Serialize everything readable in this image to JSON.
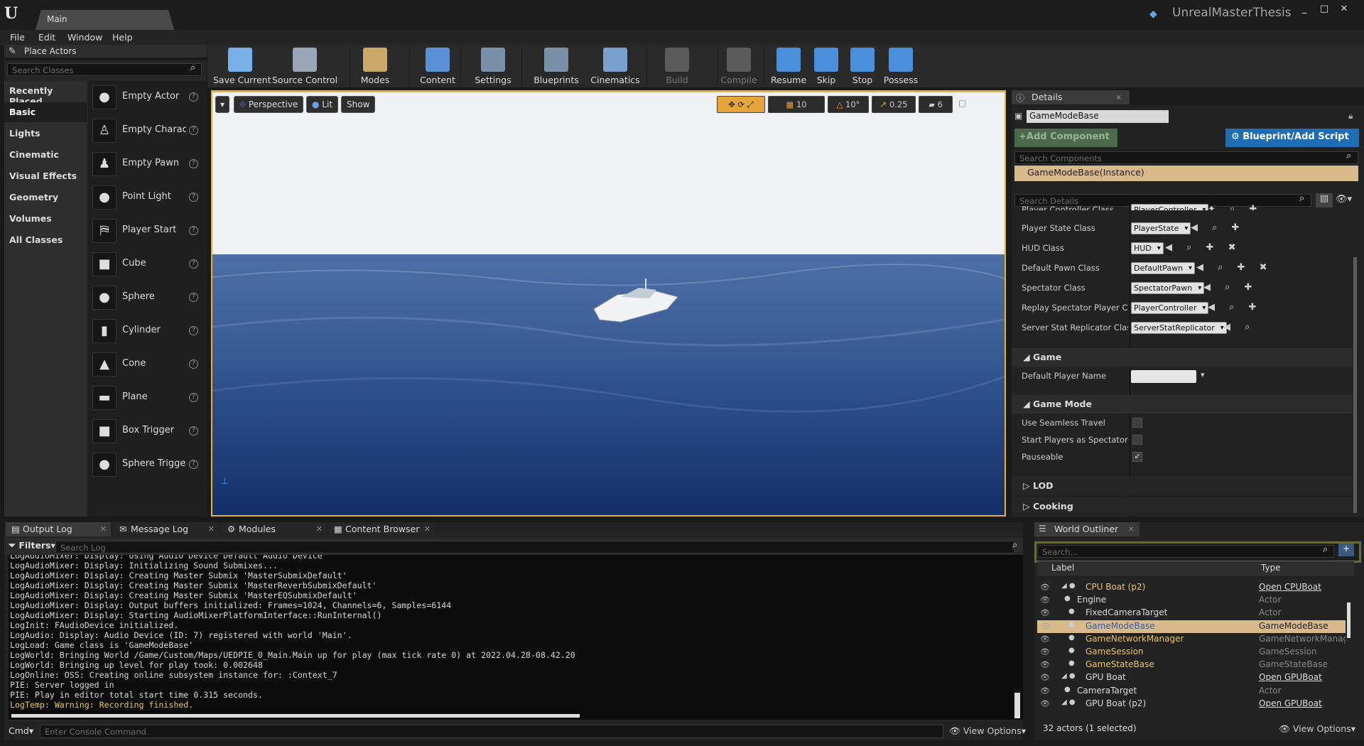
{
  "app": {
    "tab": "Main",
    "project": "UnrealMasterThesis",
    "win_min": "_",
    "win_max": "□",
    "win_close": "✕"
  },
  "menu": [
    "File",
    "Edit",
    "Window",
    "Help"
  ],
  "place_actors": {
    "title": "Place Actors",
    "search_placeholder": "Search Classes",
    "categories": [
      "Recently Placed",
      "Basic",
      "Lights",
      "Cinematic",
      "Visual Effects",
      "Geometry",
      "Volumes",
      "All Classes"
    ],
    "selected_category": "Basic",
    "actors": [
      "Empty Actor",
      "Empty Character",
      "Empty Pawn",
      "Point Light",
      "Player Start",
      "Cube",
      "Sphere",
      "Cylinder",
      "Cone",
      "Plane",
      "Box Trigger",
      "Sphere Trigger"
    ]
  },
  "toolbar": [
    "Save Current",
    "Source Control",
    "Modes",
    "Content",
    "Settings",
    "Blueprints",
    "Cinematics",
    "Build",
    "Compile",
    "Resume",
    "Skip",
    "Stop",
    "Possess"
  ],
  "viewport": {
    "perspective": "Perspective",
    "lit": "Lit",
    "show": "Show",
    "grid": "10",
    "angle": "10°",
    "scale": "0.25",
    "camspeed": "6"
  },
  "details": {
    "title": "Details",
    "object_name": "GameModeBase",
    "add_component": "+Add Component",
    "blueprint_btn": "Blueprint/Add Script",
    "search_components": "Search Components",
    "instance": "GameModeBase(Instance)",
    "search_details": "Search Details",
    "props": [
      {
        "label": "Player Controller Class",
        "value": "PlayerController"
      },
      {
        "label": "Player State Class",
        "value": "PlayerState"
      },
      {
        "label": "HUD Class",
        "value": "HUD"
      },
      {
        "label": "Default Pawn Class",
        "value": "DefaultPawn"
      },
      {
        "label": "Spectator Class",
        "value": "SpectatorPawn"
      },
      {
        "label": "Replay Spectator Player Controller",
        "value": "PlayerController"
      },
      {
        "label": "Server Stat Replicator Class",
        "value": "ServerStatReplicator"
      }
    ],
    "game_cat": "Game",
    "default_player_name": "Default Player Name",
    "gamemode_cat": "Game Mode",
    "gm_props": [
      {
        "label": "Use Seamless Travel",
        "checked": false
      },
      {
        "label": "Start Players as Spectators",
        "checked": false
      },
      {
        "label": "Pauseable",
        "checked": true
      }
    ],
    "lod": "LOD",
    "cooking": "Cooking"
  },
  "bottom_tabs": [
    "Output Log",
    "Message Log",
    "Modules",
    "Content Browser"
  ],
  "log": {
    "filters": "Filters",
    "search_placeholder": "Search Log",
    "lines": [
      "LogAudioMixer: Display: Using Audio Device Default Audio Device",
      "LogAudioMixer: Display: Initializing Sound Submixes...",
      "LogAudioMixer: Display: Creating Master Submix 'MasterSubmixDefault'",
      "LogAudioMixer: Display: Creating Master Submix 'MasterReverbSubmixDefault'",
      "LogAudioMixer: Display: Creating Master Submix 'MasterEQSubmixDefault'",
      "LogAudioMixer: Display: Output buffers initialized: Frames=1024, Channels=6, Samples=6144",
      "LogAudioMixer: Display: Starting AudioMixerPlatformInterface::RunInternal()",
      "LogInit: FAudioDevice initialized.",
      "LogAudio: Display: Audio Device (ID: 7) registered with world 'Main'.",
      "LogLoad: Game class is 'GameModeBase'",
      "LogWorld: Bringing World /Game/Custom/Maps/UEDPIE_0_Main.Main up for play (max tick rate 0) at 2022.04.28-08.42.20",
      "LogWorld: Bringing up level for play took: 0.002648",
      "LogOnline: OSS: Creating online subsystem instance for: :Context_7",
      "PIE: Server logged in",
      "PIE: Play in editor total start time 0.315 seconds.",
      "LogTemp: Warning: Recording finished."
    ],
    "cmd": "Cmd",
    "console_placeholder": "Enter Console Command",
    "view_options": "View Options"
  },
  "outliner": {
    "title": "World Outliner",
    "search_placeholder": "Search...",
    "col_label": "Label",
    "col_type": "Type",
    "rows": [
      {
        "label": "CPU Boat (p2)",
        "type": "Open CPUBoat",
        "link": true,
        "indent": 1,
        "sel": false,
        "gold": true
      },
      {
        "label": "Engine",
        "type": "Actor",
        "link": false,
        "indent": 2,
        "sel": false,
        "gold": false
      },
      {
        "label": "FixedCameraTarget",
        "type": "Actor",
        "link": false,
        "indent": 1,
        "sel": false,
        "gold": false
      },
      {
        "label": "GameModeBase",
        "type": "GameModeBase",
        "link": false,
        "indent": 1,
        "sel": true,
        "gold": true
      },
      {
        "label": "GameNetworkManager",
        "type": "GameNetworkManager",
        "link": false,
        "indent": 1,
        "sel": false,
        "gold": true
      },
      {
        "label": "GameSession",
        "type": "GameSession",
        "link": false,
        "indent": 1,
        "sel": false,
        "gold": true
      },
      {
        "label": "GameStateBase",
        "type": "GameStateBase",
        "link": false,
        "indent": 1,
        "sel": false,
        "gold": true
      },
      {
        "label": "GPU Boat",
        "type": "Open GPUBoat",
        "link": true,
        "indent": 1,
        "sel": false,
        "gold": false
      },
      {
        "label": "CameraTarget",
        "type": "Actor",
        "link": false,
        "indent": 2,
        "sel": false,
        "gold": false
      },
      {
        "label": "GPU Boat (p2)",
        "type": "Open GPUBoat",
        "link": true,
        "indent": 1,
        "sel": false,
        "gold": false
      }
    ],
    "count": "32 actors (1 selected)",
    "view_options": "View Options"
  }
}
